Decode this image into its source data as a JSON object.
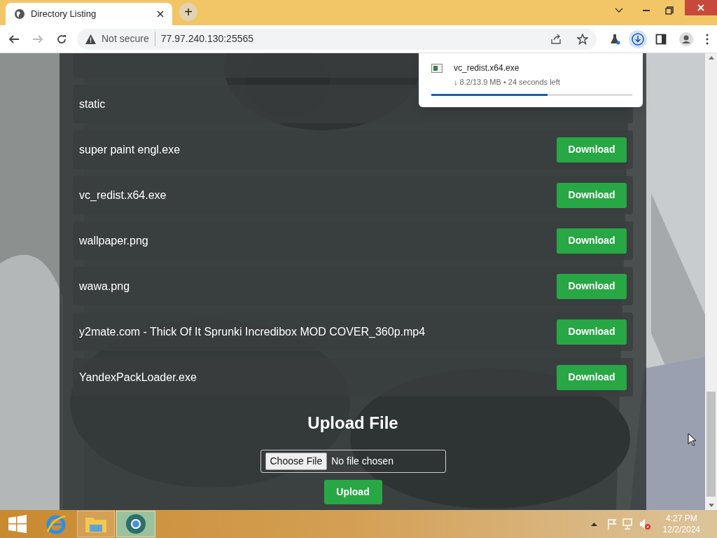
{
  "browser": {
    "tab": {
      "title": "Directory Listing"
    },
    "new_tab": "+",
    "address": {
      "security": "Not secure",
      "url": "77.97.240.130:25565"
    }
  },
  "download_popup": {
    "filename": "vc_redist.x64.exe",
    "status": "↓ 8.2/13.9 MB • 24 seconds left",
    "level": 0.58
  },
  "files": [
    {
      "name": "static"
    },
    {
      "name": "super paint engl.exe",
      "button": "Download"
    },
    {
      "name": "vc_redist.x64.exe",
      "button": "Download"
    },
    {
      "name": "wallpaper.png",
      "button": "Download"
    },
    {
      "name": "wawa.png",
      "button": "Download"
    },
    {
      "name": "y2mate.com - Thick Of It Sprunki Incredibox MOD COVER_360p.mp4",
      "button": "Download"
    },
    {
      "name": "YandexPackLoader.exe",
      "button": "Download"
    }
  ],
  "upload": {
    "title": "Upload File",
    "choose_button": "Choose File",
    "file_status": "No file chosen",
    "submit": "Upload"
  },
  "taskbar": {
    "time": "4:27 PM",
    "date": "12/2/2024"
  }
}
